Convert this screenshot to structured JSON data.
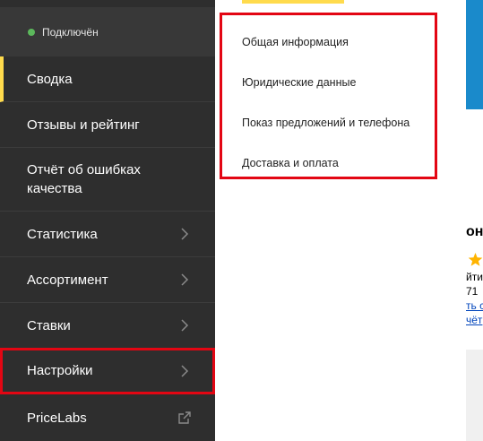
{
  "status": {
    "text": "Подключён",
    "color": "#5cb85c"
  },
  "sidebar": {
    "items": [
      {
        "label": "Сводка",
        "active": true
      },
      {
        "label": "Отзывы и рейтинг"
      },
      {
        "label": "Отчёт об ошибках качества"
      },
      {
        "label": "Статистика",
        "icon": "chevron-right-icon"
      },
      {
        "label": "Ассортимент",
        "icon": "chevron-right-icon"
      },
      {
        "label": "Ставки",
        "icon": "chevron-right-icon"
      },
      {
        "label": "Настройки",
        "icon": "chevron-right-icon",
        "highlighted": true
      },
      {
        "label": "PriceLabs",
        "icon": "external-link-icon"
      }
    ]
  },
  "submenu": {
    "items": [
      {
        "label": "Общая информация"
      },
      {
        "label": "Юридические данные"
      },
      {
        "label": "Показ предложений и телефона"
      },
      {
        "label": "Доставка и оплата"
      }
    ]
  },
  "peek": {
    "heading": "онт",
    "line1": "йти",
    "line2": "71",
    "line3": "ть с",
    "line4": "чёт"
  },
  "colors": {
    "sidebar_bg": "#2e2e2e",
    "accent_yellow": "#ffdb4d",
    "highlight_red": "#e30613",
    "brand_blue": "#1a8acb"
  }
}
